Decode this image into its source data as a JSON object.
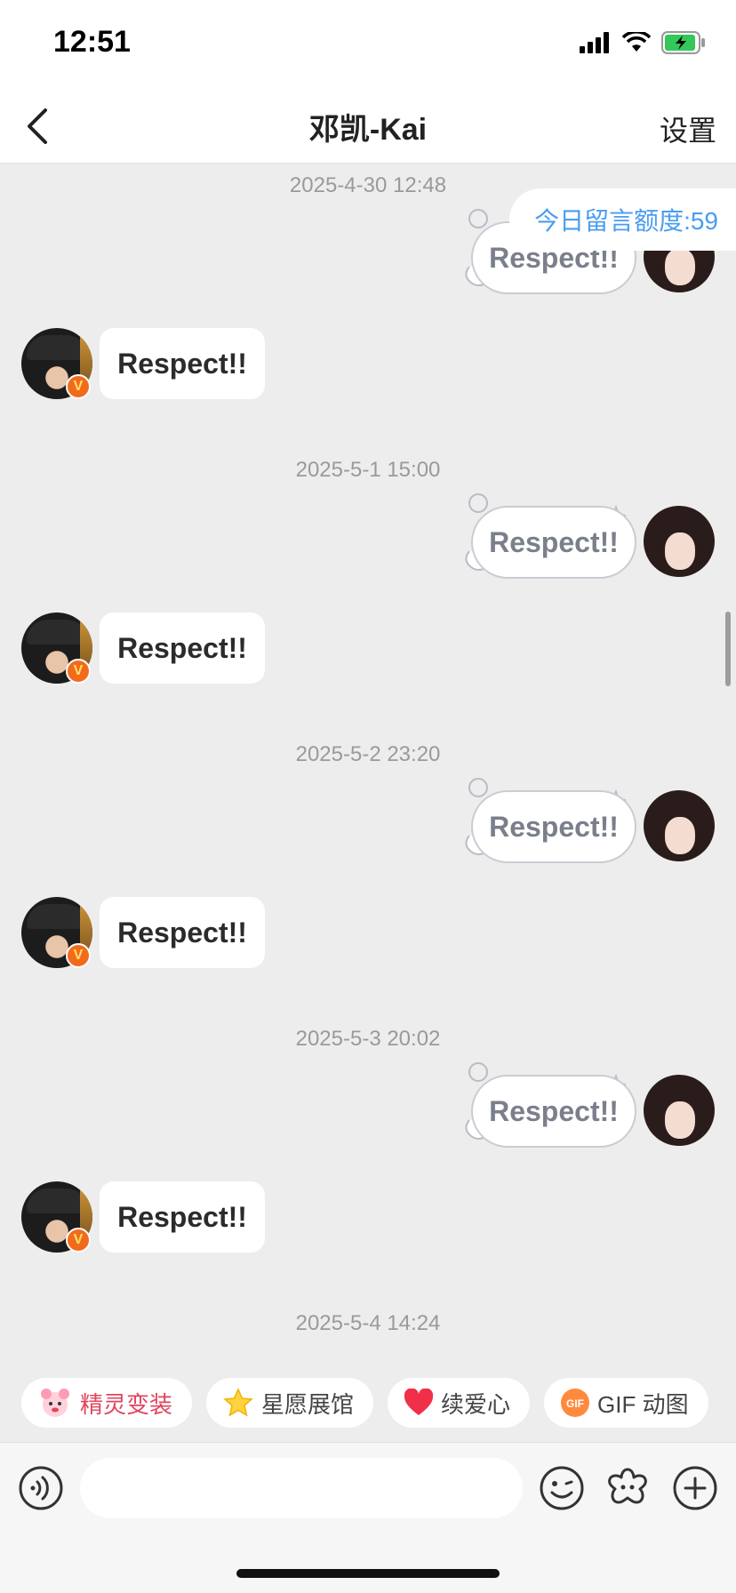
{
  "status_bar": {
    "time": "12:51"
  },
  "header": {
    "title": "邓凯-Kai",
    "settings_label": "设置"
  },
  "quota": {
    "label": "今日留言额度:59"
  },
  "messages": [
    {
      "timestamp": "2025-4-30 12:48",
      "mine": "Respect!!",
      "theirs": "Respect!!"
    },
    {
      "timestamp": "2025-5-1 15:00",
      "mine": "Respect!!",
      "theirs": "Respect!!"
    },
    {
      "timestamp": "2025-5-2 23:20",
      "mine": "Respect!!",
      "theirs": "Respect!!"
    },
    {
      "timestamp": "2025-5-3 20:02",
      "mine": "Respect!!",
      "theirs": "Respect!!"
    },
    {
      "timestamp": "2025-5-4 14:24"
    }
  ],
  "badge_letter": "V",
  "quick_actions": [
    {
      "label": "精灵变装",
      "icon": "sprite-icon"
    },
    {
      "label": "星愿展馆",
      "icon": "star-icon"
    },
    {
      "label": "续爱心",
      "icon": "heart-icon"
    },
    {
      "label": "GIF 动图",
      "icon": "gif-icon"
    }
  ],
  "colors": {
    "accent": "#4a9df0",
    "badge": "#f26b1d",
    "background": "#ededed"
  }
}
